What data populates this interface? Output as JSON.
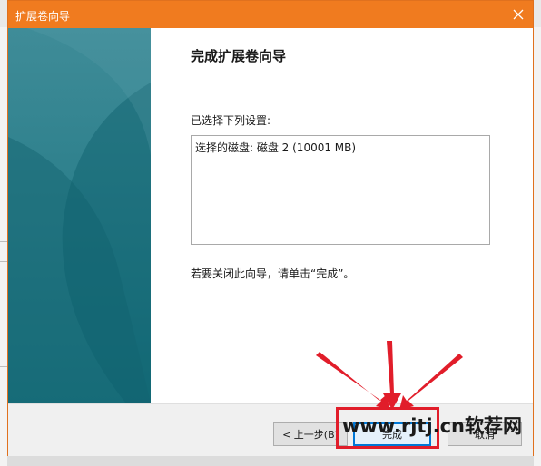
{
  "window": {
    "title": "扩展卷向导",
    "close_icon": "close-icon"
  },
  "wizard": {
    "heading": "完成扩展卷向导",
    "settings_label": "已选择下列设置:",
    "settings": [
      "选择的磁盘: 磁盘 2 (10001 MB)"
    ],
    "finish_hint": "若要关闭此向导，请单击“完成”。"
  },
  "buttons": {
    "back": "< 上一步(B)",
    "finish": "完成",
    "cancel": "取消"
  },
  "annotation": {
    "watermark": "www.rjtj.cn软荐网",
    "highlight_color": "#e11d2a"
  },
  "colors": {
    "titlebar": "#f07b1f",
    "side_panel": "#1f6f7d",
    "focus_border": "#0078d7"
  }
}
